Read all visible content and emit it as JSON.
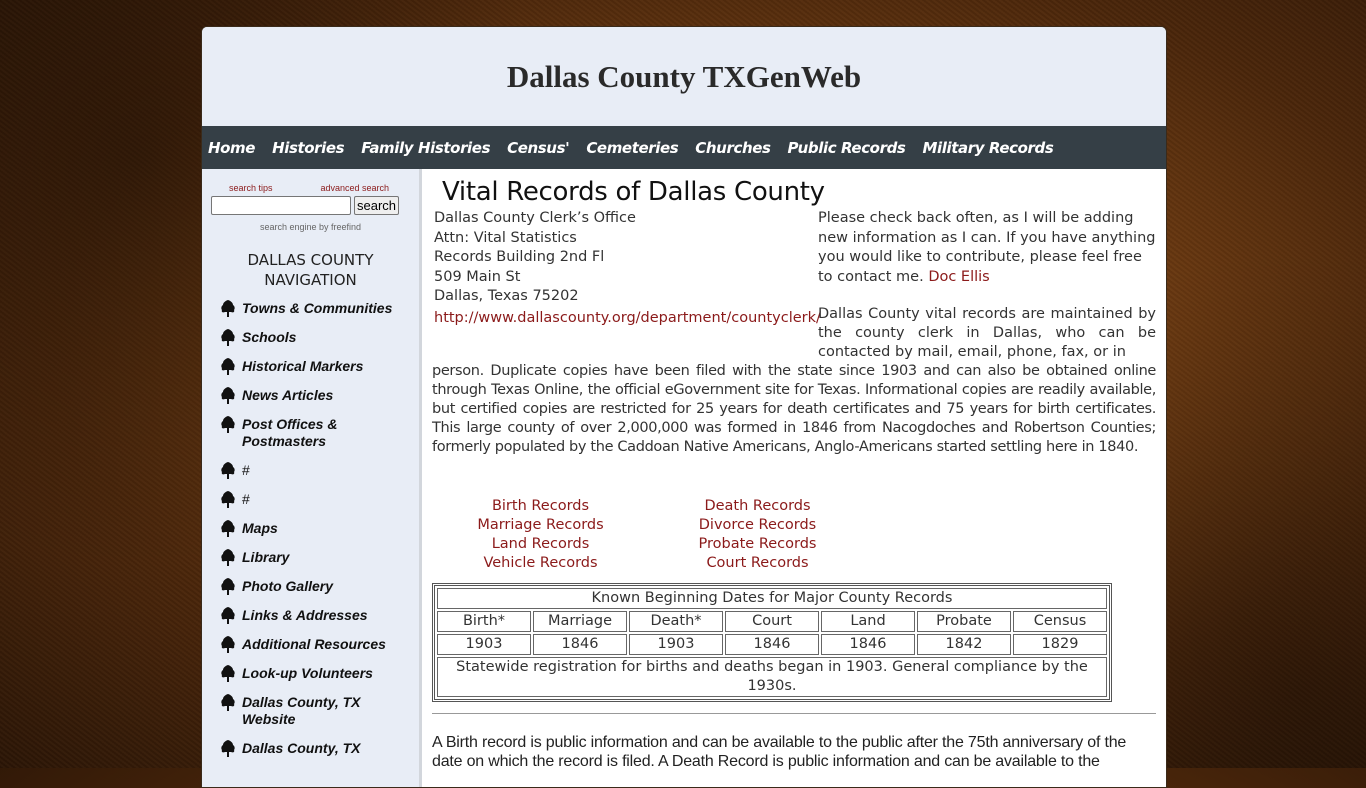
{
  "site": {
    "title": "Dallas County TXGenWeb"
  },
  "topnav": [
    {
      "label": "Home"
    },
    {
      "label": "Histories"
    },
    {
      "label": "Family Histories"
    },
    {
      "label": "Census'"
    },
    {
      "label": "Cemeteries"
    },
    {
      "label": "Churches"
    },
    {
      "label": "Public Records"
    },
    {
      "label": "Military Records"
    }
  ],
  "search": {
    "tips_label": "search tips",
    "advanced_label": "advanced search",
    "input_value": "",
    "button_label": "search",
    "engine_note": "search engine by freefind"
  },
  "sidebar": {
    "heading_line1": "DALLAS COUNTY",
    "heading_line2": "NAVIGATION",
    "items": [
      {
        "label": "Towns & Communities",
        "icon": "tree-icon"
      },
      {
        "label": "Schools",
        "icon": "tree-icon"
      },
      {
        "label": "Historical Markers",
        "icon": "tree-icon"
      },
      {
        "label": "News Articles",
        "icon": "tree-icon"
      },
      {
        "label": "Post Offices & Postmasters",
        "icon": "tree-icon"
      },
      {
        "label": "#",
        "icon": "tree-icon"
      },
      {
        "label": "#",
        "icon": "tree-icon"
      },
      {
        "label": "Maps",
        "icon": "tree-icon"
      },
      {
        "label": "Library",
        "icon": "tree-icon"
      },
      {
        "label": "Photo Gallery",
        "icon": "tree-icon"
      },
      {
        "label": "Links & Addresses",
        "icon": "tree-icon"
      },
      {
        "label": "Additional Resources",
        "icon": "tree-icon"
      },
      {
        "label": "Look-up Volunteers",
        "icon": "tree-icon"
      },
      {
        "label": "Dallas County, TX Website",
        "icon": "tree-icon"
      },
      {
        "label": "Dallas County, TX",
        "icon": "tree-icon"
      }
    ]
  },
  "main": {
    "title": "Vital Records of Dallas County",
    "address": {
      "line1": "Dallas County Clerk’s Office",
      "line2": "Attn: Vital Statistics",
      "line3": "Records Building 2nd Fl",
      "line4": "509 Main St",
      "line5": "Dallas, Texas 75202",
      "url": "http://www.dallascounty.org/department/countyclerk/"
    },
    "contact_note": {
      "text": "Please check back often, as I will be adding new information as I can. If you have anything you would like to contribute, please feel free to contact me. ",
      "link_label": "Doc Ellis"
    },
    "description_top": "Dallas County vital records are maintained by the county clerk in Dallas, who can be contacted by mail, email, phone, fax, or in",
    "description_bottom": "person. Duplicate copies have been filed with the state since 1903 and can also be obtained online through Texas Online, the official eGovernment site for Texas. Informational copies are readily available, but certified copies are restricted for 25 years for death certificates and 75 years for birth certificates. This large county of over 2,000,000 was formed in 1846 from Nacogdoches and Robertson Counties; formerly populated by the Caddoan Native Americans, Anglo-Americans started settling here in 1840.",
    "record_links_left": [
      "Birth Records",
      "Marriage Records",
      "Land Records",
      "Vehicle Records"
    ],
    "record_links_right": [
      "Death Records",
      "Divorce Records",
      "Probate Records",
      "Court Records"
    ],
    "dates_table": {
      "caption": "Known Beginning Dates for Major County Records",
      "headers": [
        "Birth*",
        "Marriage",
        "Death*",
        "Court",
        "Land",
        "Probate",
        "Census"
      ],
      "values": [
        "1903",
        "1846",
        "1903",
        "1846",
        "1846",
        "1842",
        "1829"
      ],
      "footnote": "Statewide registration for births and deaths began in 1903. General compliance by the 1930s."
    },
    "birth_note": "A Birth record is public information and can be available to the public after the 75th anniversary of the date on which the record is filed. A Death Record is public information and can be available to the"
  },
  "colors": {
    "header_bg": "#e8edf6",
    "nav_bg": "#353f46",
    "link": "#8b1a1a",
    "sidebar_bg": "#e8edf6"
  }
}
